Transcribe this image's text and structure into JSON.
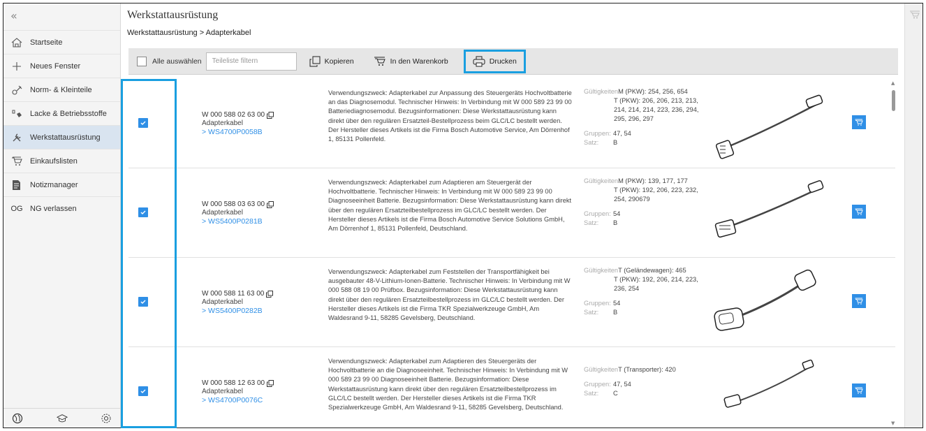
{
  "sidebar": {
    "collapse_glyph": "«",
    "items": [
      {
        "label": "Startseite",
        "icon": "home-icon"
      },
      {
        "label": "Neues Fenster",
        "icon": "plus-icon"
      },
      {
        "label": "Norm- & Kleinteile",
        "icon": "parts-icon"
      },
      {
        "label": "Lacke & Betriebsstoffe",
        "icon": "paint-icon"
      },
      {
        "label": "Werkstattausrüstung",
        "icon": "tools-icon",
        "active": true
      },
      {
        "label": "Einkaufslisten",
        "icon": "cart-icon"
      },
      {
        "label": "Notizmanager",
        "icon": "note-icon"
      },
      {
        "label": "NG verlassen",
        "icon": "og-text-icon",
        "icon_text": "OG"
      }
    ],
    "bottom_icons": [
      "globe-icon",
      "graduation-cap-icon",
      "settings-icon"
    ]
  },
  "page": {
    "title": "Werkstattausrüstung",
    "breadcrumb": "Werkstattausrüstung > Adapterkabel"
  },
  "toolbar": {
    "select_all_label": "Alle auswählen",
    "filter_placeholder": "Teileliste filtern",
    "copy_label": "Kopieren",
    "cart_label": "In den Warenkorb",
    "print_label": "Drucken"
  },
  "rows": [
    {
      "part_number": "W 000 588 02 63 00",
      "type": "Adapterkabel",
      "link": "> WS4700P0058B",
      "description": "Verwendungszweck: Adapterkabel zur Anpassung des Steuergeräts Hochvoltbatterie an das Diagnosemodul. Technischer Hinweis: In Verbindung mit W 000 589 23 99 00 Batteriediagnosemodul. Bezugsinformationen: Diese Werkstattausrüstung kann direkt über den regulären Ersatzteil-Bestellprozess beim GLC/LC bestellt werden. Der Hersteller dieses Artikels ist die Firma Bosch Automotive Service, Am Dörrenhof 1, 85131 Pollenfeld.",
      "validity_label": "Gültigkeiten",
      "validity_first": "M (PKW): 254, 256, 654",
      "validity_rest": "T (PKW): 206, 206, 213, 213, 214, 214, 214, 223, 236, 294, 295, 296, 297",
      "groups_label": "Gruppen:",
      "groups": "47, 54",
      "set_label": "Satz:",
      "set": "B"
    },
    {
      "part_number": "W 000 588 03 63 00",
      "type": "Adapterkabel",
      "link": "> WS5400P0281B",
      "description": "Verwendungszweck: Adapterkabel zum Adaptieren am Steuergerät der Hochvoltbatterie. Technischer Hinweis: In Verbindung mit W 000 589 23 99 00 Diagnoseeinheit Batterie. Bezugsinformation: Diese Werkstattausrüstung kann direkt über den regulären Ersatzteilbestellprozess im GLC/LC bestellt werden. Der Hersteller dieses Artikels ist die Firma Bosch Automotive Service Solutions GmbH, Am Dörrenhof 1, 85131 Pollenfeld, Deutschland.",
      "validity_label": "Gültigkeiten",
      "validity_first": "M (PKW): 139, 177, 177",
      "validity_rest": "T (PKW): 192, 206, 223, 232, 254, 290679",
      "groups_label": "Gruppen:",
      "groups": "54",
      "set_label": "Satz:",
      "set": "B"
    },
    {
      "part_number": "W 000 588 11 63 00",
      "type": "Adapterkabel",
      "link": "> WS5400P0282B",
      "description": "Verwendungszweck: Adapterkabel zum Feststellen der Transportfähigkeit bei ausgebauter 48-V-Lithium-Ionen-Batterie. Technischer Hinweis: In Verbindung mit W 000 588 08 19 00 Prüfbox. Bezugsinformation: Diese Werkstattausrüstung kann direkt über den regulären Ersatzteilbestellprozess im GLC/LC bestellt werden. Der Hersteller dieses Artikels ist die Firma TKR Spezialwerkzeuge GmbH, Am Waldesrand 9-11, 58285 Gevelsberg, Deutschland.",
      "validity_label": "Gültigkeiten",
      "validity_first": "T (Geländewagen): 465",
      "validity_rest": "T (PKW): 192, 206, 214, 223, 236, 254",
      "groups_label": "Gruppen:",
      "groups": "54",
      "set_label": "Satz:",
      "set": "B"
    },
    {
      "part_number": "W 000 588 12 63 00",
      "type": "Adapterkabel",
      "link": "> WS4700P0076C",
      "description": "Verwendungszweck: Adapterkabel zum Adaptieren des Steuergeräts der Hochvoltbatterie an die Diagnoseeinheit. Technischer Hinweis: In Verbindung mit W 000 589 23 99 00 Diagnoseeinheit Batterie. Bezugsinformation: Diese Werkstattausrüstung kann direkt über den regulären Ersatzteilbestellprozess im GLC/LC bestellt werden. Der Hersteller dieses Artikels ist die Firma TKR Spezialwerkzeuge GmbH, Am Waldesrand 9-11, 58285 Gevelsberg, Deutschland.",
      "validity_label": "Gültigkeiten",
      "validity_first": "T (Transporter): 420",
      "validity_rest": "",
      "groups_label": "Gruppen:",
      "groups": "47, 54",
      "set_label": "Satz:",
      "set": "C"
    }
  ],
  "colors": {
    "accent": "#2f8fe6",
    "highlight": "#1a9fe0",
    "active_nav": "#d9e4f0"
  }
}
